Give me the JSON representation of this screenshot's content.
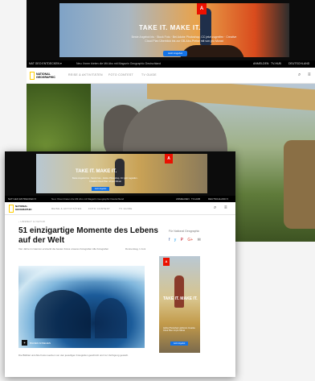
{
  "colors": {
    "adobe_red": "#eb1000",
    "ng_yellow": "#ffce00",
    "cta_blue": "#1473e6",
    "topbar": "#000000"
  },
  "back": {
    "ad": {
      "title": "TAKE IT. MAKE IT.",
      "subtitle": "Beste Angebot bis · Stock Foto · Bei Adobe Photoshop, CC jetzt zugreifen · Creative Cloud Plan Überblick bis zur GB-Abo-Preise mit von pro Monat",
      "button": "Jetzt Angebot",
      "logo": "A"
    },
    "topbar": {
      "left": "NAT GEO ENTDECKEN ▾",
      "middle": "Neu: Ihnen bieten die Mit Abo mit Magazin Geographic Deutschland",
      "links": [
        "ANMELDEN",
        "TV-HUB",
        "DEUTSCHLAND"
      ]
    },
    "nav": {
      "logo_line1": "NATIONAL",
      "logo_line2": "GEOGRAPHIC",
      "items": [
        "REISE & AKTIVITÄTEN",
        "FOTO CONTEST",
        "TV GUIDE"
      ]
    }
  },
  "front": {
    "ad": {
      "title": "TAKE IT. MAKE IT.",
      "subtitle": "Beste Angebot bis · Stock Foto · Adobe Photoshop, CC jetzt zugreifen · Creative Cloud Plan mit pro Monat",
      "button": "Jetzt Angebot",
      "logo": "A"
    },
    "topbar": {
      "left": "NAT GEO ENTDECKEN ▾",
      "middle": "Neu: Ihnen bieten die Mit Abo mit Magazin Geographic Deutschland",
      "links": [
        "ANMELDEN",
        "TV-HUB",
        "DEUTSCHLAND ▾"
      ]
    },
    "nav": {
      "logo_line1": "NATIONAL",
      "logo_line2": "GEOGRAPHIC",
      "items": [
        "REISE & AKTIVITÄTEN",
        "FOTO CONTEST",
        "TV GUIDE"
      ]
    },
    "article": {
      "breadcrumb": "‹ UMWELT & NATUR",
      "headline": "51 einzigartige Momente des Lebens auf der Welt",
      "dek": "Vier Jahre im Ganzen erstreckt die besten Fotos unseres Fotografen Alle Fotografen",
      "date": "Donnerstag, 1 Juni",
      "follow": "Für National Geographic",
      "gallery_label": "BILDER ANSEHEN",
      "gallery_icon": "+",
      "caption": "Die Bildtitel und Alle Fotos werden von den jeweiligen Fotografen geschützt und zur Verfügung gestellt."
    },
    "rail_ad": {
      "title": "TAKE IT. MAKE IT.",
      "subtitle": "Adobe Photoshop Lightroom Creative Cloud Plan mit pro Monat",
      "button": "Jetzt Angebot",
      "logo": "A"
    },
    "social_icons": [
      "f",
      "y",
      "P",
      "G+",
      "✉"
    ]
  }
}
